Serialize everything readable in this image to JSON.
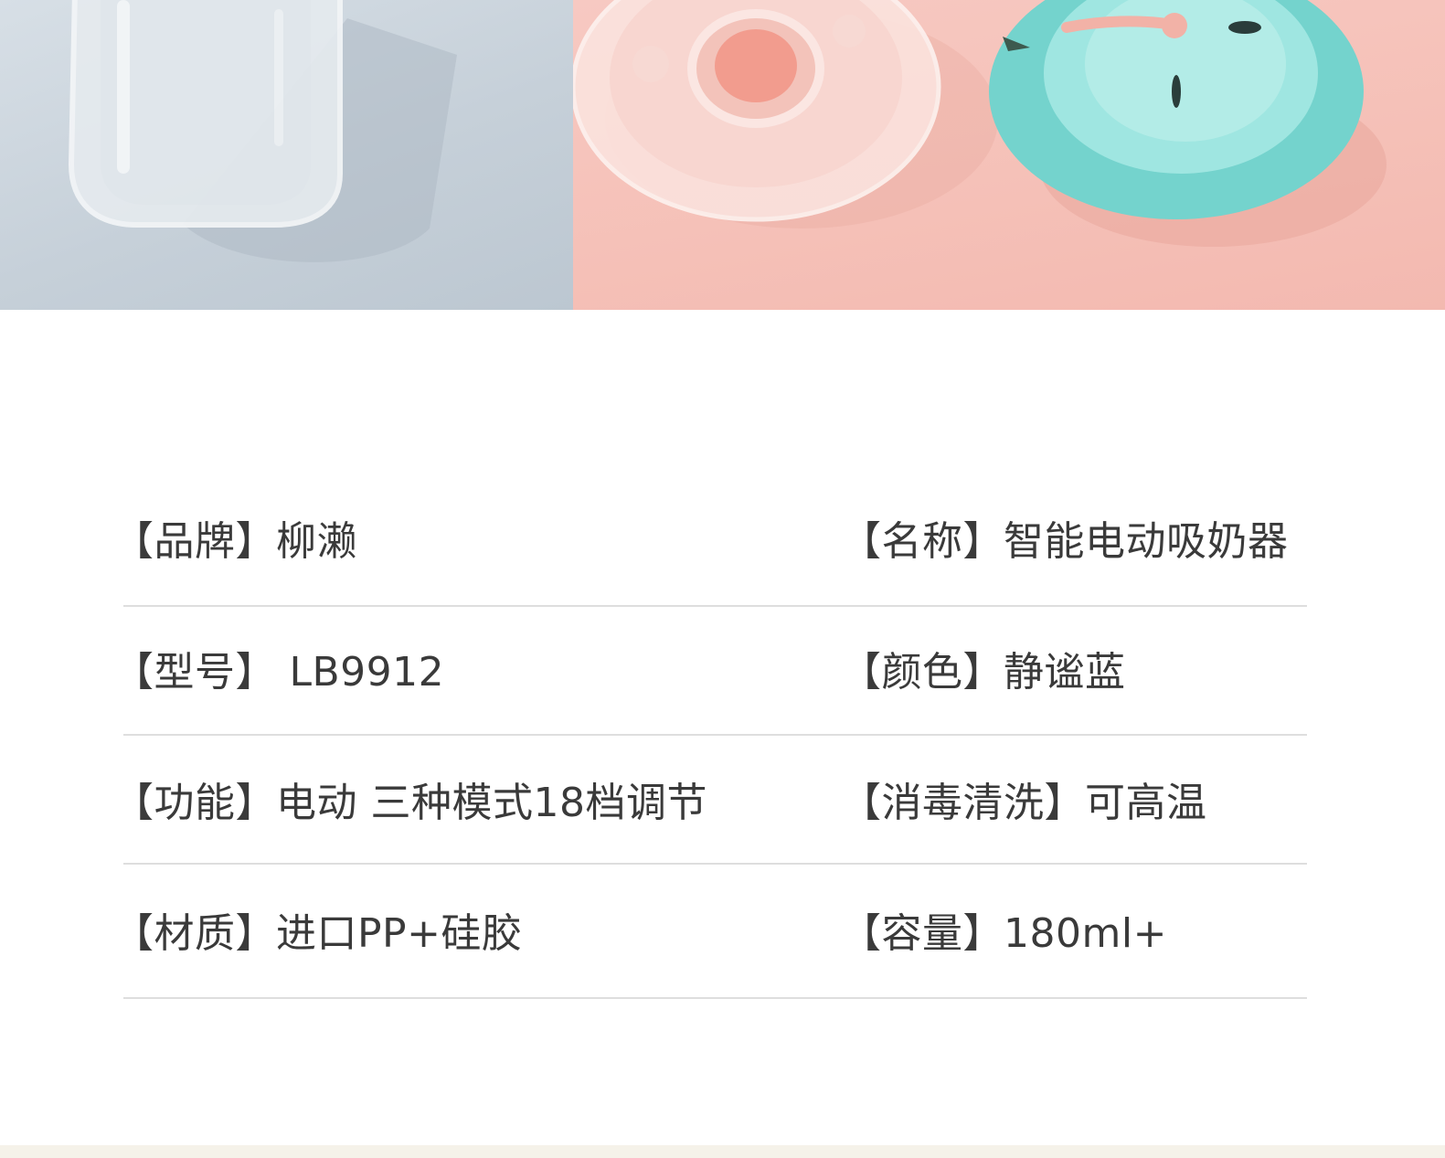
{
  "specs": [
    {
      "label": "【品牌】",
      "value": "柳濑"
    },
    {
      "label": "【名称】",
      "value": "智能电动吸奶器"
    },
    {
      "label": "【型号】",
      "value": " LB9912"
    },
    {
      "label": "【颜色】",
      "value": "静谧蓝"
    },
    {
      "label": "【功能】",
      "value": "电动 三种模式18档调节"
    },
    {
      "label": "【消毒清洗】",
      "value": "可高温"
    },
    {
      "label": "【材质】",
      "value": "进口PP+硅胶"
    },
    {
      "label": "【容量】",
      "value": "180ml+"
    }
  ],
  "colors": {
    "text": "#3a3a3a",
    "divider": "#dedede",
    "photo_left_bg": "#c6d0d9",
    "photo_right_bg": "#f5c0b7",
    "funnel_teal": "#7fd9d4",
    "bottom_strip": "#f5f2e9"
  }
}
